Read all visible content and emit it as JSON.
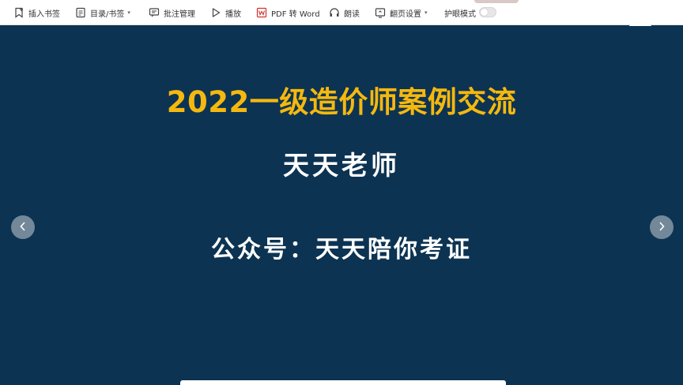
{
  "toolbar": {
    "insert_bookmark": "插入书签",
    "toc_bookmark": "目录/书签",
    "annotation_manage": "批注管理",
    "play": "播放",
    "pdf_to_word": "PDF 转 Word",
    "read_aloud": "朗读",
    "page_settings": "翻页设置",
    "eye_protection": "护眼模式",
    "eye_protection_on": false
  },
  "slide": {
    "title": "2022一级造价师案例交流",
    "teacher": "天天老师",
    "account": "公众号：天天陪你考证",
    "background_color": "#0c3352",
    "title_color": "#f5b80f"
  },
  "icons": {
    "prev": "chevron-left-icon",
    "next": "chevron-right-icon",
    "scroll_top": "chevron-up-icon"
  }
}
